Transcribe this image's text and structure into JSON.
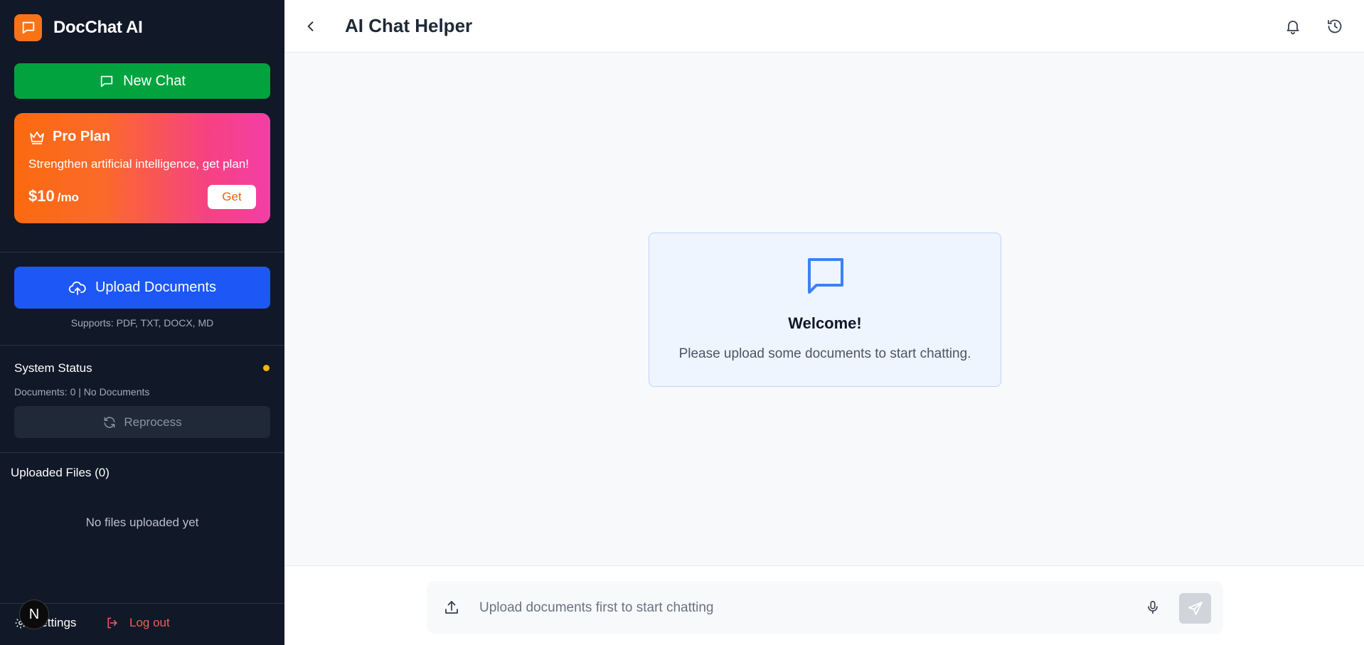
{
  "sidebar": {
    "brand": {
      "name": "DocChat AI",
      "logo_icon": "chat-bubble-icon",
      "accent": "#f97316"
    },
    "new_chat": {
      "label": "New Chat",
      "icon": "chat-icon",
      "color": "#02a33e"
    },
    "pro_plan": {
      "title": "Pro Plan",
      "icon": "crown-icon",
      "description": "Strengthen artificial intelligence, get plan!",
      "price": "$10",
      "period": "/mo",
      "button_label": "Get",
      "gradient": [
        "#fb6a0f",
        "#f43ea6"
      ]
    },
    "upload": {
      "label": "Upload Documents",
      "icon": "cloud-upload-icon",
      "supports": "Supports: PDF, TXT, DOCX, MD",
      "color": "#1d57f5"
    },
    "system_status": {
      "title": "System Status",
      "indicator_color": "#f5b50a",
      "documents": "Documents: 0 | No Documents",
      "reprocess_label": "Reprocess"
    },
    "uploaded_files": {
      "title": "Uploaded Files (0)",
      "empty_text": "No files uploaded yet"
    },
    "footer": {
      "settings_label": "Settings",
      "logout_label": "Log out",
      "badge_letter": "N",
      "logout_color": "#f75b5b"
    }
  },
  "header": {
    "title": "AI Chat Helper",
    "icons": [
      "back-chevron-icon",
      "bell-icon",
      "history-icon"
    ]
  },
  "welcome": {
    "title": "Welcome!",
    "message": "Please upload some documents to start chatting.",
    "icon": "chat-bubble-icon",
    "accent": "#3b82f6"
  },
  "composer": {
    "placeholder": "Upload documents first to start chatting",
    "value": ""
  }
}
